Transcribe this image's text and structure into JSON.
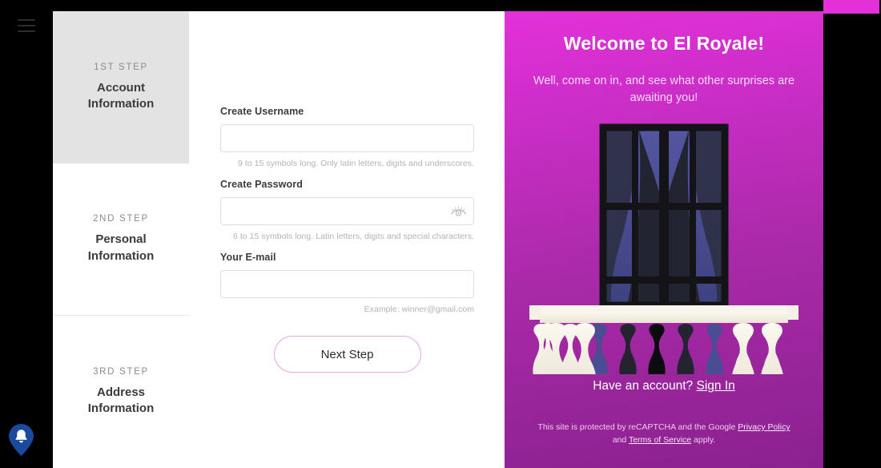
{
  "os": {
    "menu_icon": "hamburger-menu-icon",
    "notification_icon": "bell-pin-icon"
  },
  "sidebar": {
    "steps": [
      {
        "kicker": "1ST STEP",
        "title_line1": "Account",
        "title_line2": "Information",
        "active": true
      },
      {
        "kicker": "2ND STEP",
        "title_line1": "Personal",
        "title_line2": "Information",
        "active": false
      },
      {
        "kicker": "3RD STEP",
        "title_line1": "Address",
        "title_line2": "Information",
        "active": false
      }
    ]
  },
  "form": {
    "username": {
      "label": "Create Username",
      "value": "",
      "placeholder": "",
      "hint": "9 to 15 symbols long. Only latin letters, digits and underscores."
    },
    "password": {
      "label": "Create Password",
      "value": "",
      "placeholder": "",
      "hint": "6 to 15 symbols long. Latin letters, digits and special characters.",
      "toggle_icon": "eye-icon"
    },
    "email": {
      "label": "Your E-mail",
      "value": "",
      "placeholder": "",
      "hint": "Example: winner@gmail.com"
    },
    "submit_label": "Next Step"
  },
  "promo": {
    "title": "Welcome to El Royale!",
    "subtitle": "Well, come on in, and see what other surprises are awaiting you!",
    "signin_prefix": "Have an account? ",
    "signin_link": "Sign In",
    "legal_prefix": "This site is protected by reCAPTCHA and the Google ",
    "legal_link1": "Privacy Policy",
    "legal_mid": " and ",
    "legal_link2": "Terms of Service",
    "legal_suffix": " apply.",
    "illustration": "balcony-window-illustration"
  },
  "colors": {
    "promo_gradient_start": "#e431d9",
    "promo_gradient_end": "#8b2190",
    "accent_button_border": "#e7a8e4",
    "sidebar_active_bg": "#e3e3e3",
    "bell_blue": "#1a4a9e",
    "balustrade_cream": "#f4efe4",
    "window_frame": "#141418",
    "window_glass": "#4c4f93"
  }
}
